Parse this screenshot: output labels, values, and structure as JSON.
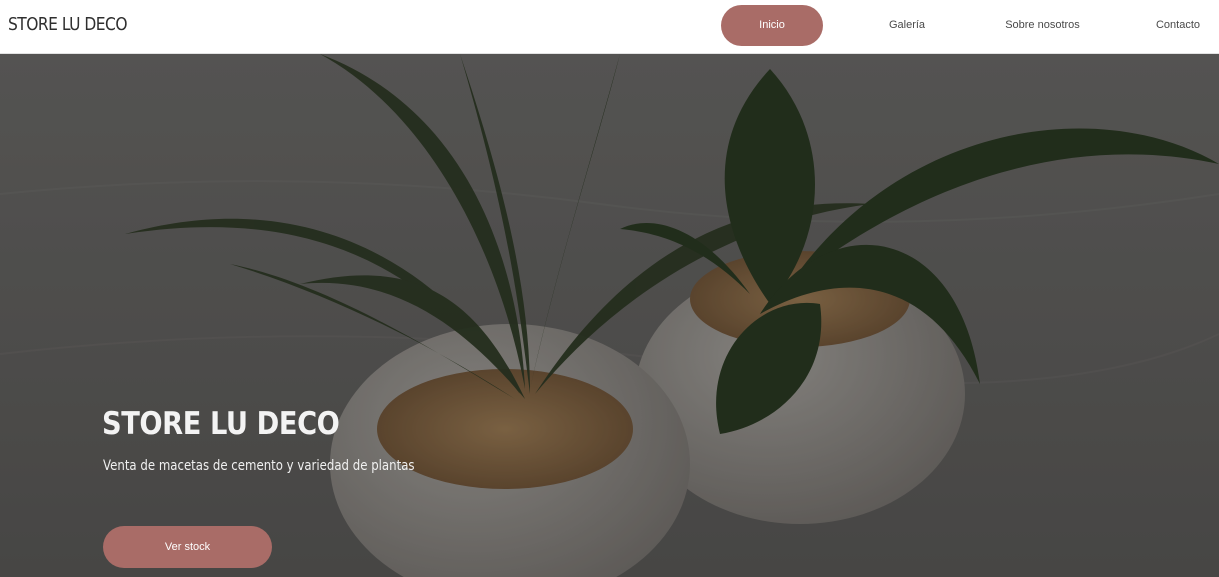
{
  "header": {
    "brand": "STORE LU DECO",
    "nav": [
      {
        "label": "Inicio",
        "active": true
      },
      {
        "label": "Galería",
        "active": false
      },
      {
        "label": "Sobre nosotros",
        "active": false
      },
      {
        "label": "Contacto",
        "active": false
      }
    ]
  },
  "hero": {
    "title": "STORE LU DECO",
    "subtitle": "Venta de macetas de cemento y variedad de plantas",
    "cta_label": "Ver stock",
    "image": "plant-pots-photo"
  },
  "colors": {
    "accent": "#a96c67",
    "header_bg": "#ffffff",
    "hero_text": "#f3f3f3"
  }
}
